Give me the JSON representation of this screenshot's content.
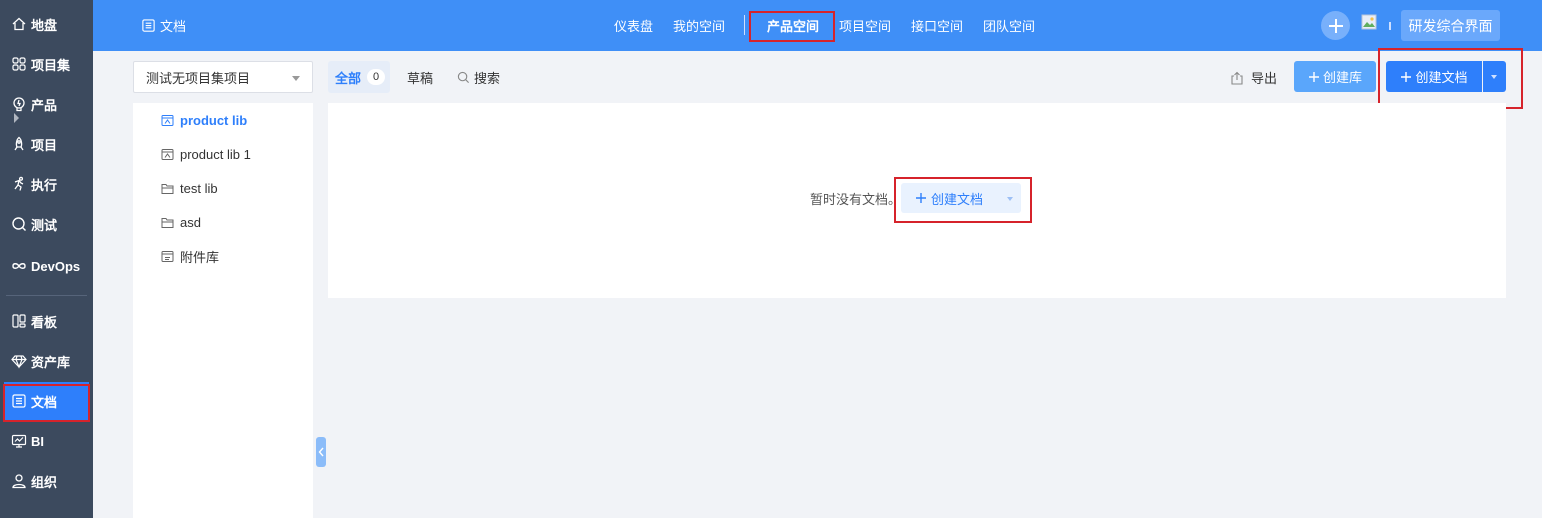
{
  "sidebar": {
    "items": [
      {
        "label": "地盘",
        "icon": "home-icon"
      },
      {
        "label": "项目集",
        "icon": "grid-icon"
      },
      {
        "label": "产品",
        "icon": "bulb-icon"
      },
      {
        "label": "项目",
        "icon": "rocket-icon"
      },
      {
        "label": "执行",
        "icon": "run-icon"
      },
      {
        "label": "测试",
        "icon": "magnifier-icon"
      },
      {
        "label": "DevOps",
        "icon": "infinity-icon"
      },
      {
        "label": "看板",
        "icon": "kanban-icon"
      },
      {
        "label": "资产库",
        "icon": "diamond-icon"
      },
      {
        "label": "文档",
        "icon": "document-icon",
        "active": true
      },
      {
        "label": "BI",
        "icon": "monitor-icon"
      },
      {
        "label": "组织",
        "icon": "user-icon"
      }
    ]
  },
  "header": {
    "title": "文档",
    "nav": [
      "仪表盘",
      "我的空间",
      "产品空间",
      "项目空间",
      "接口空间",
      "团队空间"
    ],
    "active_nav": "产品空间",
    "workspace_label": "研发综合界面"
  },
  "toolbar": {
    "project_select": "测试无项目集项目",
    "tab_all": "全部",
    "tab_all_count": "0",
    "tab_draft": "草稿",
    "tab_search": "搜索",
    "export_label": "导出",
    "create_lib_label": "创建库",
    "create_doc_label": "创建文档"
  },
  "tree": {
    "items": [
      {
        "label": "product lib",
        "icon": "product-lib-icon",
        "active": true
      },
      {
        "label": "product lib 1",
        "icon": "product-lib-icon"
      },
      {
        "label": "test lib",
        "icon": "folder-icon"
      },
      {
        "label": "asd",
        "icon": "folder-icon"
      },
      {
        "label": "附件库",
        "icon": "attachment-lib-icon"
      }
    ]
  },
  "main": {
    "empty_text": "暂时没有文档。",
    "create_doc_label": "创建文档"
  },
  "colors": {
    "sidebar_bg": "#3c4a5e",
    "topbar_bg": "#3f8ff7",
    "accent": "#2e7ffb",
    "highlight_border": "#d6232b"
  }
}
